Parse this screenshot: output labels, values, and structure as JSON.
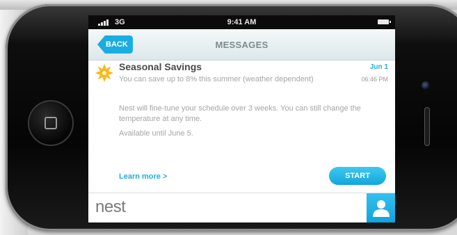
{
  "status_bar": {
    "network": "3G",
    "time": "9:41 AM"
  },
  "nav": {
    "back_label": "BACK",
    "title": "MESSAGES"
  },
  "message": {
    "icon": "sun-icon",
    "title": "Seasonal Savings",
    "date": "Jun 1",
    "time": "06:46 PM",
    "body_line1": "You can save up to 8% this summer (weather dependent)",
    "body_line2": "Nest will fine-tune your schedule over 3 weeks. You can still change the temperature at any time.",
    "body_line3": "Available  until June 5.",
    "learn_more": "Learn more >",
    "start_label": "START"
  },
  "footer": {
    "logo_text": "nest",
    "profile_icon": "person-icon"
  },
  "colors": {
    "accent": "#21aee0",
    "sun": "#f5b81c",
    "text_muted": "#a5a5a5"
  }
}
